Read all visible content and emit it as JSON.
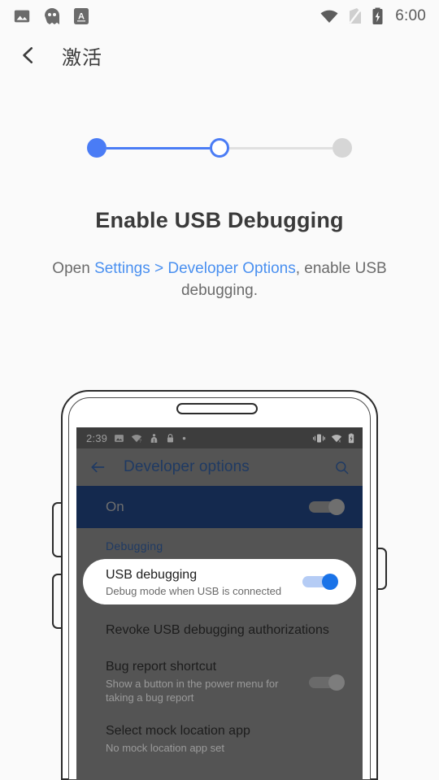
{
  "status_bar": {
    "icons_left": [
      "image-icon",
      "ghost-icon",
      "letter-a-icon"
    ],
    "icons_right": [
      "wifi-icon",
      "sim-off-icon",
      "battery-charging-icon"
    ],
    "time": "6:00"
  },
  "app_bar": {
    "back_icon": "back-chevron-icon",
    "title": "激活"
  },
  "stepper": {
    "steps": [
      {
        "state": "done"
      },
      {
        "state": "current"
      },
      {
        "state": "todo"
      }
    ],
    "active_color": "#4a7cf5",
    "inactive_color": "#d6d6d6"
  },
  "content": {
    "headline": "Enable USB Debugging",
    "subtext_before": "Open ",
    "subtext_link": "Settings > Developer Options",
    "subtext_after": ", enable USB debugging.",
    "link_color": "#4a90f0"
  },
  "phone": {
    "status_bar": {
      "time": "2:39",
      "icons_left": [
        "image-icon",
        "wifi-question-icon",
        "people-icon",
        "lock-icon",
        "dot-icon"
      ],
      "icons_right": [
        "vibrate-icon",
        "wifi-off-icon",
        "battery-icon"
      ]
    },
    "app_bar": {
      "back_icon": "arrow-back-icon",
      "title": "Developer options",
      "search_icon": "search-icon"
    },
    "on_row": {
      "label": "On",
      "toggle_state": "on"
    },
    "section_header": "Debugging",
    "highlighted_item": {
      "title": "USB debugging",
      "subtitle": "Debug mode when USB is connected",
      "toggle_state": "on"
    },
    "items": [
      {
        "title": "Revoke USB debugging authorizations",
        "subtitle": "",
        "toggle": false
      },
      {
        "title": "Bug report shortcut",
        "subtitle": "Show a button in the power menu for taking a bug report",
        "toggle": true,
        "toggle_state": "off"
      },
      {
        "title": "Select mock location app",
        "subtitle": "No mock location app set",
        "toggle": false
      }
    ]
  }
}
